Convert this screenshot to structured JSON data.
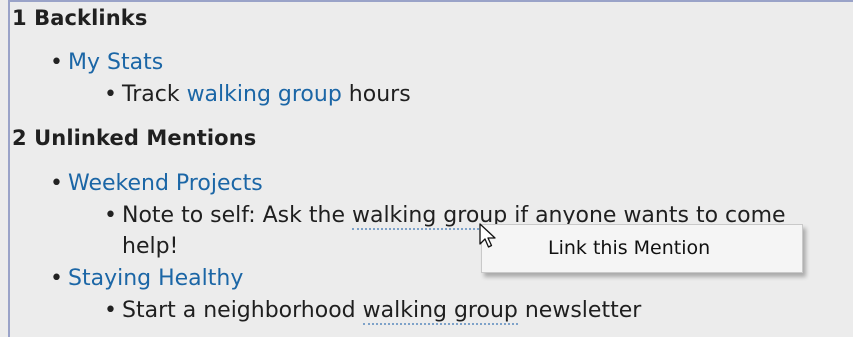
{
  "backlinks": {
    "title": "1 Backlinks",
    "items": [
      {
        "page": "My Stats",
        "child_prefix": "Track ",
        "child_link": "walking group",
        "child_suffix": " hours"
      }
    ]
  },
  "unlinked": {
    "title": "2 Unlinked Mentions",
    "items": [
      {
        "page": "Weekend Projects",
        "child_prefix": "Note to self: Ask the ",
        "child_mention": "walking group",
        "child_suffix": " if anyone wants to come",
        "child_wrap": "help!"
      },
      {
        "page": "Staying Healthy",
        "child_prefix": "Start a neighborhood ",
        "child_mention": "walking group",
        "child_suffix": " newsletter"
      }
    ]
  },
  "context_menu": {
    "item_label": "Link this Mention"
  },
  "colors": {
    "link": "#1b66a6",
    "background": "#ececec",
    "frame_border": "#9aa3c8"
  },
  "icons": {
    "cursor": "mouse-pointer-icon",
    "bullet": "bullet-dot-icon"
  }
}
